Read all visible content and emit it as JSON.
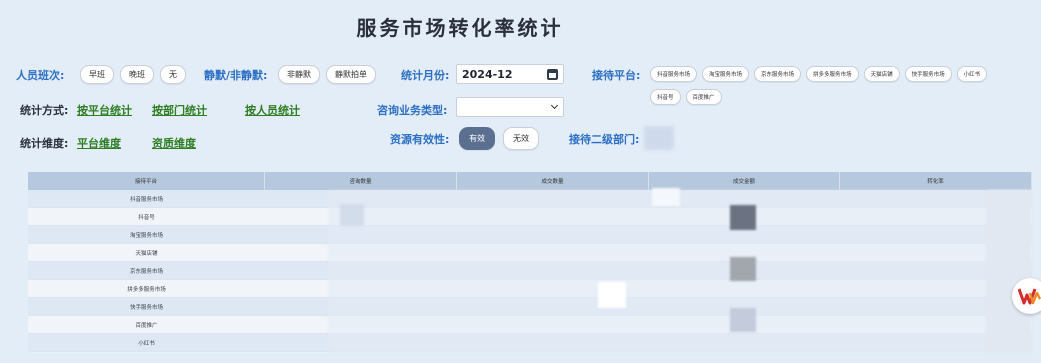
{
  "title": "服务市场转化率统计",
  "filters": {
    "shift": {
      "label": "人员班次:",
      "options": [
        "早班",
        "晚班",
        "无"
      ]
    },
    "silent": {
      "label": "静默/非静默:",
      "options": [
        "非静默",
        "静默拍单"
      ]
    },
    "month": {
      "label": "统计月份:",
      "value": "2024-12"
    },
    "platform": {
      "label": "接待平台:",
      "options": [
        "抖音服务市场",
        "淘宝服务市场",
        "京东服务市场",
        "拼多多服务市场",
        "天猫店铺",
        "快手服务市场",
        "小红书",
        "抖音号",
        "百度推广"
      ]
    },
    "method": {
      "label": "统计方式:",
      "links": [
        "按平台统计",
        "按部门统计",
        "按人员统计"
      ]
    },
    "consult_type": {
      "label": "咨询业务类型:",
      "value": ""
    },
    "dimension": {
      "label": "统计维度:",
      "links": [
        "平台维度",
        "资质维度"
      ]
    },
    "validity": {
      "label": "资源有效性:",
      "options": [
        "有效",
        "无效"
      ],
      "active": "有效"
    },
    "dept2": {
      "label": "接待二级部门:"
    }
  },
  "table": {
    "columns": [
      "接待平台",
      "咨询数量",
      "成交数量",
      "成交金额",
      "转化率"
    ],
    "rows": [
      "抖音服务市场",
      "抖音号",
      "淘宝服务市场",
      "天猫店铺",
      "京东服务市场",
      "拼多多服务市场",
      "快手服务市场",
      "百度推广",
      "小红书"
    ]
  },
  "floating": {
    "icon": "w-logo-icon"
  }
}
